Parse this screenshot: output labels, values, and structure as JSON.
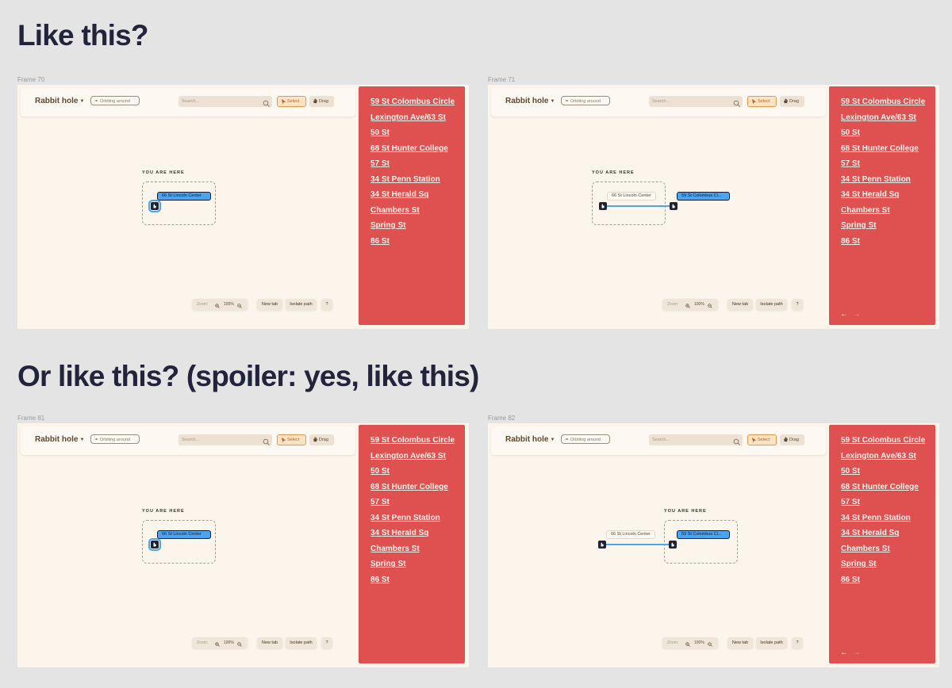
{
  "headings": {
    "first": "Like this?",
    "second": "Or like this? (spoiler: yes, like this)"
  },
  "frames": [
    {
      "label": "Frame 70",
      "variant": "single",
      "show_arrows": false
    },
    {
      "label": "Frame 71",
      "variant": "linked-left",
      "show_arrows": true
    },
    {
      "label": "Frame 81",
      "variant": "single",
      "show_arrows": false
    },
    {
      "label": "Frame 82",
      "variant": "linked-right",
      "show_arrows": true
    }
  ],
  "app": {
    "title": "Rabbit hole",
    "mode": "Orbiting around",
    "search_placeholder": "Search...",
    "select_label": "Select",
    "drag_label": "Drag",
    "zoom_label": "Zoom:",
    "zoom_value": "100%",
    "new_tab": "New tab",
    "isolate_path": "Isolate path",
    "help": "?",
    "you_are_here": "YOU ARE HERE",
    "current_node": "66 St Lincoln Center",
    "linked_node": "59 St Colombus Ci..."
  },
  "stations": [
    "59 St Colombus Circle",
    "Lexington Ave/63 St",
    "50 St",
    "68 St Hunter College",
    "57 St",
    "34 St Penn Station",
    "34 St Herald Sq",
    "Chambers St",
    "Spring St",
    "86 St"
  ],
  "nav": {
    "prev_arrow": "←",
    "next_arrow": "→"
  },
  "colors": {
    "page_bg": "#e4e4e4",
    "frame_bg": "#fbf5ec",
    "panel_red": "#df5150",
    "node_blue": "#4aa4f0",
    "select_orange": "#e49a4d"
  }
}
